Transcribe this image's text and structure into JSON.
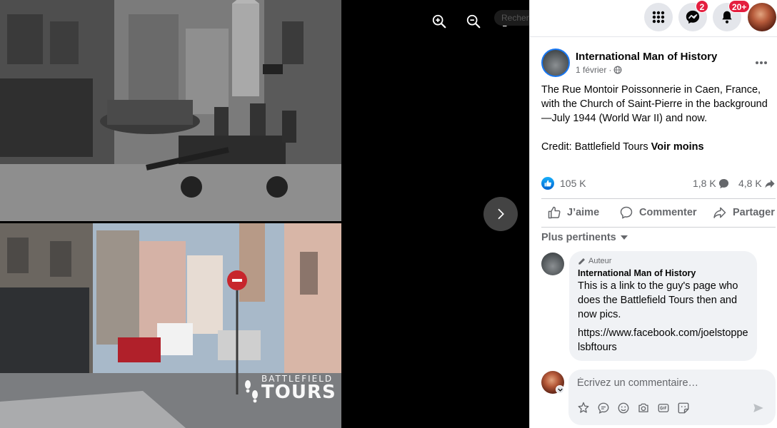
{
  "viewer": {
    "search_ghost": "Rechercher sur Facebook",
    "watermark_line1": "BATTLEFIELD",
    "watermark_line2": "TOURS",
    "tools": [
      "zoom-in-icon",
      "zoom-out-icon",
      "fullscreen-icon"
    ]
  },
  "topbar": {
    "messenger_badge": "2",
    "notifications_badge": "20+"
  },
  "post": {
    "page_name": "International Man of History",
    "date": "1 février",
    "audience_icon": "globe-icon",
    "text_paragraph1": "The Rue Montoir Poissonnerie in Caen, France, with the Church of Saint-Pierre in the background—July 1944 (World War II) and now.",
    "text_paragraph2_prefix": "Credit: Battlefield Tours ",
    "see_less": "Voir moins",
    "likes": "105 K",
    "comments": "1,8 K",
    "shares": "4,8 K"
  },
  "actions": {
    "like": "J’aime",
    "comment": "Commenter",
    "share": "Partager"
  },
  "comments": {
    "sort_label": "Plus pertinents",
    "items": [
      {
        "author_tag": "Auteur",
        "name": "International Man of History",
        "text": "This is a link to the guy's page who does the Battlefield Tours then and now pics.",
        "link": "https://www.facebook.com/joelstoppelsbftours"
      }
    ]
  },
  "composer": {
    "placeholder": "Écrivez un commentaire…"
  },
  "colors": {
    "brand_blue": "#1877f2",
    "badge_red": "#e41e3f",
    "secondary_text": "#65676b"
  }
}
